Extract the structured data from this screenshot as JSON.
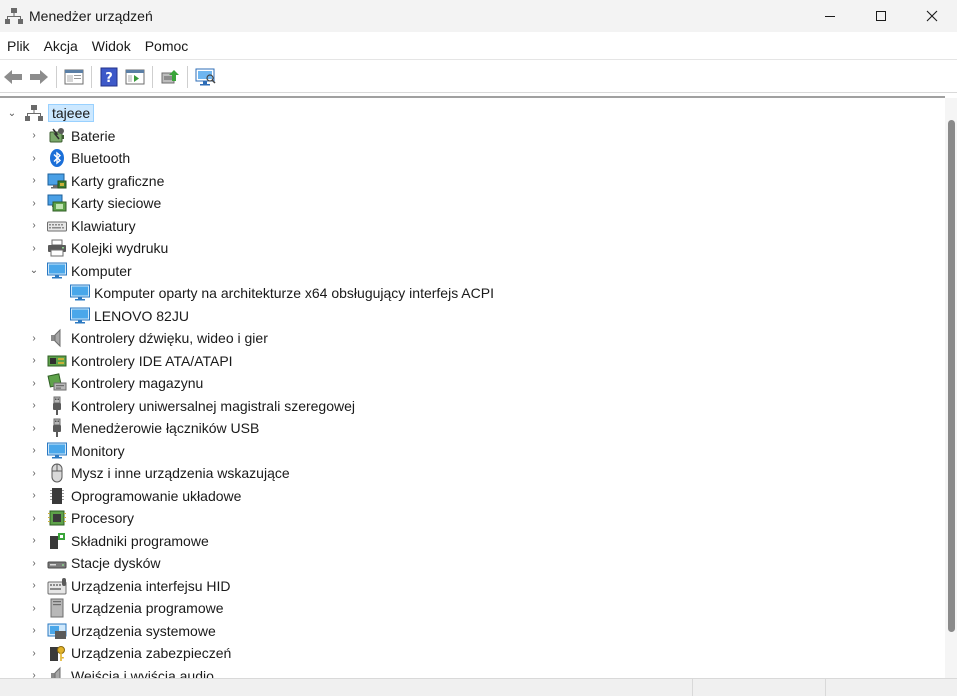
{
  "window": {
    "title": "Menedżer urządzeń"
  },
  "menu": [
    "Plik",
    "Akcja",
    "Widok",
    "Pomoc"
  ],
  "toolbar": {
    "buttons": [
      "back-icon",
      "forward-icon",
      "properties-view-icon",
      "help-icon",
      "run-icon",
      "update-driver-icon",
      "scan-hardware-icon"
    ]
  },
  "tree": {
    "root": "tajeee",
    "categories": [
      {
        "label": "Baterie",
        "icon": "battery-icon",
        "expanded": false
      },
      {
        "label": "Bluetooth",
        "icon": "bluetooth-icon",
        "expanded": false
      },
      {
        "label": "Karty graficzne",
        "icon": "display-adapter-icon",
        "expanded": false
      },
      {
        "label": "Karty sieciowe",
        "icon": "network-adapter-icon",
        "expanded": false
      },
      {
        "label": "Klawiatury",
        "icon": "keyboard-icon",
        "expanded": false
      },
      {
        "label": "Kolejki wydruku",
        "icon": "printer-icon",
        "expanded": false
      },
      {
        "label": "Komputer",
        "icon": "computer-icon",
        "expanded": true,
        "children": [
          {
            "label": "Komputer oparty na architekturze x64 obsługujący interfejs ACPI",
            "icon": "computer-icon"
          },
          {
            "label": "LENOVO 82JU",
            "icon": "computer-icon"
          }
        ]
      },
      {
        "label": "Kontrolery dźwięku, wideo i gier",
        "icon": "speaker-icon",
        "expanded": false
      },
      {
        "label": "Kontrolery IDE ATA/ATAPI",
        "icon": "ide-controller-icon",
        "expanded": false
      },
      {
        "label": "Kontrolery magazynu",
        "icon": "storage-controller-icon",
        "expanded": false
      },
      {
        "label": "Kontrolery uniwersalnej magistrali szeregowej",
        "icon": "usb-icon",
        "expanded": false
      },
      {
        "label": "Menedżerowie łączników USB",
        "icon": "usb-icon",
        "expanded": false
      },
      {
        "label": "Monitory",
        "icon": "monitor-icon",
        "expanded": false
      },
      {
        "label": "Mysz i inne urządzenia wskazujące",
        "icon": "mouse-icon",
        "expanded": false
      },
      {
        "label": "Oprogramowanie układowe",
        "icon": "firmware-icon",
        "expanded": false
      },
      {
        "label": "Procesory",
        "icon": "processor-icon",
        "expanded": false
      },
      {
        "label": "Składniki programowe",
        "icon": "software-component-icon",
        "expanded": false
      },
      {
        "label": "Stacje dysków",
        "icon": "disk-drive-icon",
        "expanded": false
      },
      {
        "label": "Urządzenia interfejsu HID",
        "icon": "hid-icon",
        "expanded": false
      },
      {
        "label": "Urządzenia programowe",
        "icon": "software-device-icon",
        "expanded": false
      },
      {
        "label": "Urządzenia systemowe",
        "icon": "system-device-icon",
        "expanded": false
      },
      {
        "label": "Urządzenia zabezpieczeń",
        "icon": "security-device-icon",
        "expanded": false
      },
      {
        "label": "Wejścia i wyjścia audio",
        "icon": "audio-io-icon",
        "expanded": false
      }
    ]
  },
  "colors": {
    "selection_bg": "#cce8ff",
    "selection_border": "#99d1ff",
    "titlebar_bg": "#f3f3f3",
    "scroll_thumb": "#8a8a8a"
  }
}
